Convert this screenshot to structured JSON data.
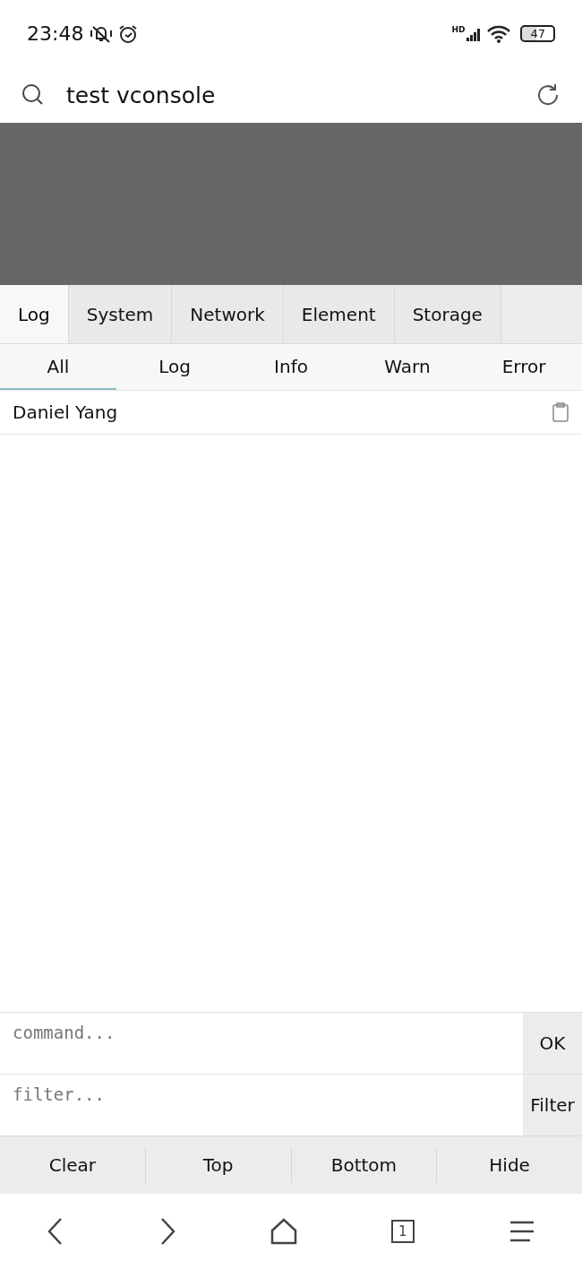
{
  "status_bar": {
    "time": "23:48",
    "network_label": "HD",
    "battery": "47"
  },
  "address_bar": {
    "query": "test vconsole"
  },
  "tabs": [
    {
      "label": "Log",
      "selected": true
    },
    {
      "label": "System",
      "selected": false
    },
    {
      "label": "Network",
      "selected": false
    },
    {
      "label": "Element",
      "selected": false
    },
    {
      "label": "Storage",
      "selected": false
    }
  ],
  "log_filters": [
    {
      "label": "All",
      "selected": true
    },
    {
      "label": "Log",
      "selected": false
    },
    {
      "label": "Info",
      "selected": false
    },
    {
      "label": "Warn",
      "selected": false
    },
    {
      "label": "Error",
      "selected": false
    }
  ],
  "log_entries": [
    {
      "text": "Daniel Yang"
    }
  ],
  "command": {
    "placeholder": "command...",
    "button": "OK"
  },
  "filter": {
    "placeholder": "filter...",
    "button": "Filter"
  },
  "toolbar": [
    "Clear",
    "Top",
    "Bottom",
    "Hide"
  ],
  "browser_nav": {
    "tab_count": "1"
  }
}
